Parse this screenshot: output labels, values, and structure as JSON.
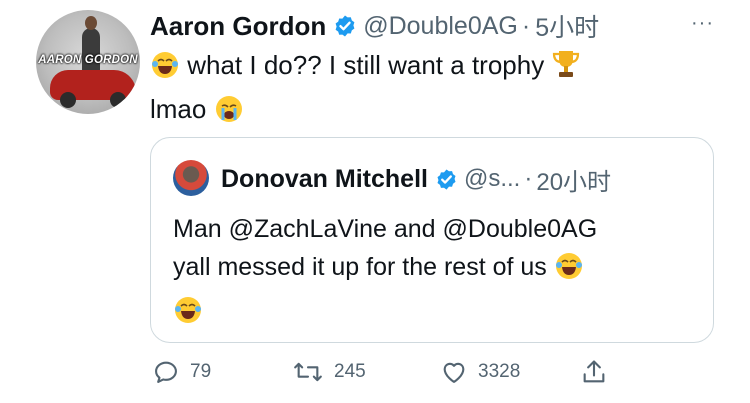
{
  "author": {
    "name": "Aaron Gordon",
    "handle": "@Double0AG",
    "time": "5小时",
    "avatar_text": "AARON GORDON"
  },
  "tweet": {
    "text_part1": "what I do?? I still want a trophy",
    "text_part2": "lmao",
    "emoji": [
      "laughing-face-emoji",
      "trophy-emoji",
      "crying-face-emoji"
    ]
  },
  "quoted_tweet": {
    "name": "Donovan Mitchell",
    "handle": "@s...",
    "time": "20小时",
    "text_line1": "Man @ZachLaVine and @Double0AG",
    "text_line2": "yall messed it up for the rest of us"
  },
  "actions": {
    "replies": "79",
    "retweets": "245",
    "likes": "3328"
  },
  "colors": {
    "verified": "#1d9bf0",
    "secondary_text": "#536471",
    "border": "#cfd9de"
  },
  "separator": "·",
  "more_label": "···"
}
